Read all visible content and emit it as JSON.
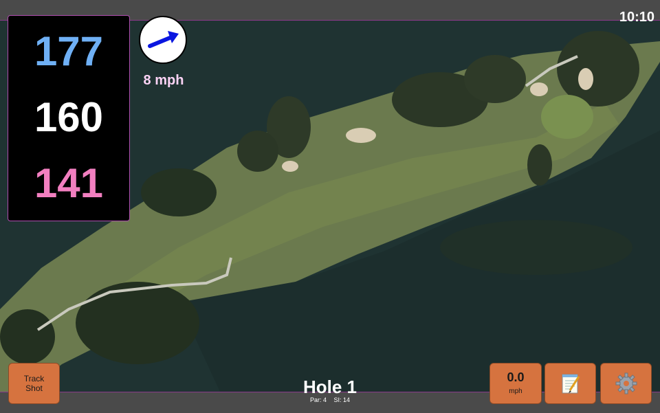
{
  "status": {
    "time": "10:10"
  },
  "distances": {
    "back": "177",
    "middle": "160",
    "front": "141"
  },
  "wind": {
    "speed": "8 mph",
    "icon": "wind-arrow-icon"
  },
  "hole": {
    "title": "Hole 1",
    "par": "Par: 4",
    "stroke_index": "SI: 14"
  },
  "buttons": {
    "track_shot_line1": "Track",
    "track_shot_line2": "Shot",
    "speed_value": "0.0",
    "speed_unit": "mph",
    "notes_icon": "notepad-icon",
    "settings_icon": "gear-icon"
  },
  "colors": {
    "back": "#6fb0f5",
    "middle": "#ffffff",
    "front": "#f27fc0",
    "accent": "#d6733f",
    "border": "#b04db0"
  }
}
